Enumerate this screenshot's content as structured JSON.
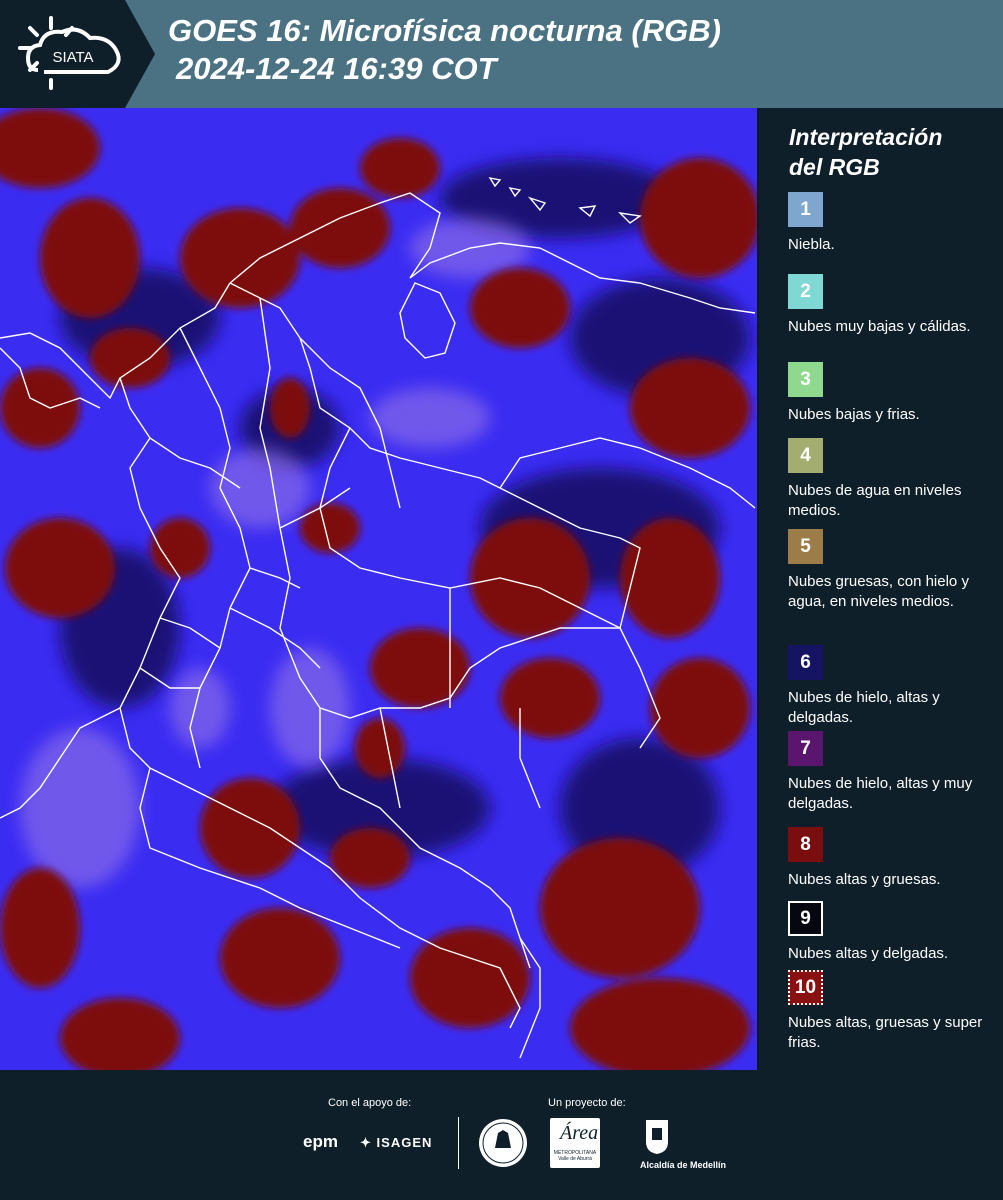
{
  "header": {
    "logo_text": "SIATA",
    "title_line1": "GOES 16: Microfísica nocturna (RGB)",
    "title_line2": "2024-12-24 16:39 COT"
  },
  "legend": {
    "title_line1": "Interpretación",
    "title_line2": "del RGB",
    "items": [
      {
        "num": "1",
        "label": "Niebla.",
        "color": "#7ea6cf"
      },
      {
        "num": "2",
        "label": "Nubes muy bajas y cálidas.",
        "color": "#7fd8d4"
      },
      {
        "num": "3",
        "label": "Nubes bajas y frias.",
        "color": "#8fd98f"
      },
      {
        "num": "4",
        "label": "Nubes de agua en niveles medios.",
        "color": "#a3ad6f"
      },
      {
        "num": "5",
        "label": "Nubes gruesas, con hielo y agua, en niveles medios.",
        "color": "#9c7d4a"
      },
      {
        "num": "6",
        "label": "Nubes de hielo, altas y delgadas.",
        "color": "#141463"
      },
      {
        "num": "7",
        "label": "Nubes de hielo, altas y muy delgadas.",
        "color": "#5a156e"
      },
      {
        "num": "8",
        "label": "Nubes altas y gruesas.",
        "color": "#7a0d0d"
      },
      {
        "num": "9",
        "label": "Nubes altas y delgadas.",
        "color": "#07070f"
      },
      {
        "num": "10",
        "label": "Nubes altas, gruesas y super frias.",
        "color": "#8a1111"
      }
    ]
  },
  "footer": {
    "support_label": "Con el apoyo de:",
    "project_label": "Un proyecto de:",
    "epm": "epm",
    "isagen": "ISAGEN",
    "area_logo_text": "Área",
    "area_logo_sub": "METROPOLITANA Valle de Aburrá",
    "medellin": "Alcaldía de Medellín"
  },
  "colors": {
    "header_bg": "#4a7282",
    "panel_bg": "#0e1f2a",
    "map_blue": "#3a28f0",
    "map_red": "#7d0c0c"
  }
}
